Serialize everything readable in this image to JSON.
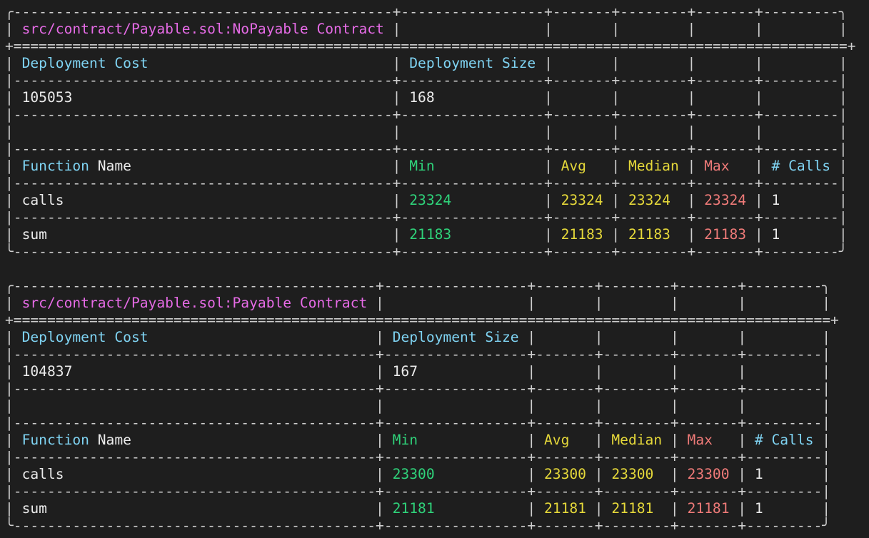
{
  "tables": [
    {
      "title": "src/contract/Payable.sol:NoPayable Contract",
      "deployment_cost_label": "Deployment Cost",
      "deployment_size_label": "Deployment Size",
      "deployment_cost": "105053",
      "deployment_size": "168",
      "headers": {
        "function_word": "Function",
        "name_word": "Name",
        "min": "Min",
        "avg": "Avg",
        "median": "Median",
        "max": "Max",
        "calls": "# Calls"
      },
      "rows": [
        {
          "name": "calls",
          "min": "23324",
          "avg": "23324",
          "median": "23324",
          "max": "23324",
          "calls": "1"
        },
        {
          "name": "sum",
          "min": "21183",
          "avg": "21183",
          "median": "21183",
          "max": "21183",
          "calls": "1"
        }
      ]
    },
    {
      "title": "src/contract/Payable.sol:Payable Contract",
      "deployment_cost_label": "Deployment Cost",
      "deployment_size_label": "Deployment Size",
      "deployment_cost": "104837",
      "deployment_size": "167",
      "headers": {
        "function_word": "Function",
        "name_word": "Name",
        "min": "Min",
        "avg": "Avg",
        "median": "Median",
        "max": "Max",
        "calls": "# Calls"
      },
      "rows": [
        {
          "name": "calls",
          "min": "23300",
          "avg": "23300",
          "median": "23300",
          "max": "23300",
          "calls": "1"
        },
        {
          "name": "sum",
          "min": "21181",
          "avg": "21181",
          "median": "21181",
          "max": "21181",
          "calls": "1"
        }
      ]
    }
  ],
  "colors": {
    "background": "#1e1e1e",
    "title": "#e66be6",
    "header": "#7fd3f2",
    "min": "#2fd27a",
    "avg_median": "#e5d83a",
    "max": "#ee7a78",
    "text": "#eaeaea"
  }
}
